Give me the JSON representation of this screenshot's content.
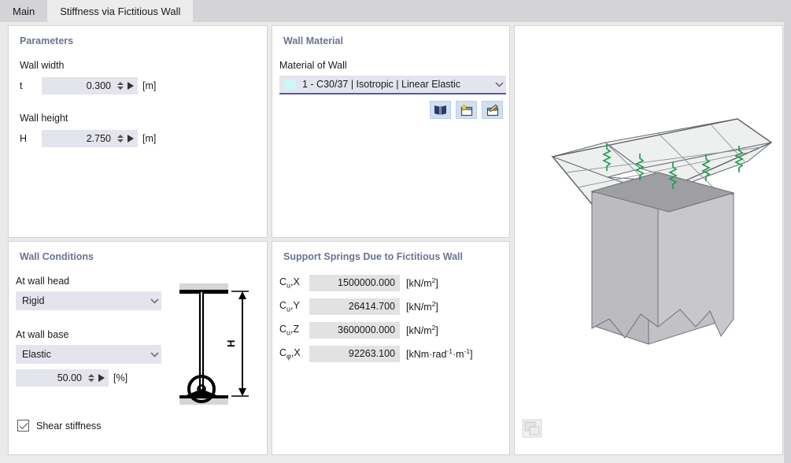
{
  "tabs": [
    {
      "label": "Main",
      "active": false
    },
    {
      "label": "Stiffness via Fictitious Wall",
      "active": true
    }
  ],
  "parameters": {
    "title": "Parameters",
    "wall_width_label": "Wall width",
    "wall_width_symbol": "t",
    "wall_width_value": "0.300",
    "wall_width_unit": "[m]",
    "wall_height_label": "Wall height",
    "wall_height_symbol": "H",
    "wall_height_value": "2.750",
    "wall_height_unit": "[m]"
  },
  "material": {
    "title": "Wall Material",
    "field_label": "Material of Wall",
    "selected": "1 - C30/37 | Isotropic | Linear Elastic",
    "swatch_color": "#ccf7f7",
    "underline_color": "#5a57a8",
    "buttons": [
      {
        "name": "material-library-icon",
        "title": "Material Library"
      },
      {
        "name": "new-material-icon",
        "title": "New Material"
      },
      {
        "name": "edit-material-icon",
        "title": "Edit Material"
      }
    ]
  },
  "conditions": {
    "title": "Wall Conditions",
    "head_label": "At wall head",
    "head_value": "Rigid",
    "base_label": "At wall base",
    "base_value": "Elastic",
    "base_percent": "50.00",
    "base_percent_unit": "[%]",
    "checkbox_label": "Shear stiffness",
    "checkbox_checked": true,
    "diagram_height_label": "H"
  },
  "springs": {
    "title": "Support Springs Due to Fictitious Wall",
    "rows": [
      {
        "symbol": "C",
        "sub": "u",
        "axis": ",X",
        "value": "1500000.000",
        "unit_prefix": "[kN/m",
        "unit_sup": "2",
        "unit_suffix": "]"
      },
      {
        "symbol": "C",
        "sub": "u",
        "axis": ",Y",
        "value": "26414.700",
        "unit_prefix": "[kN/m",
        "unit_sup": "2",
        "unit_suffix": "]"
      },
      {
        "symbol": "C",
        "sub": "u",
        "axis": ",Z",
        "value": "3600000.000",
        "unit_prefix": "[kN/m",
        "unit_sup": "2",
        "unit_suffix": "]"
      },
      {
        "symbol": "C",
        "sub": "φ",
        "axis": ",X",
        "value": "92263.100",
        "unit_rad": true
      }
    ],
    "rad_unit_text": "[kNm·rad-1·m-1]"
  },
  "viewport": {
    "spring_color": "#1f9f4f",
    "slab_color": "#eeeeee",
    "wall_color": "#b9b9bd",
    "copy_icon_name": "copy-image-icon"
  }
}
